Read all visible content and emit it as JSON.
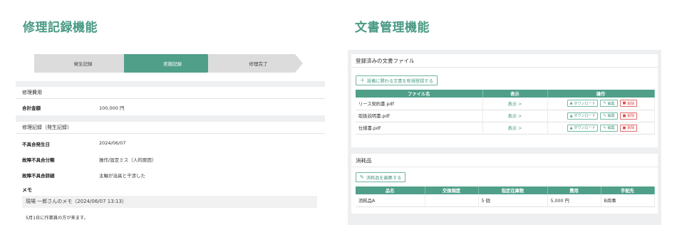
{
  "headings": {
    "left": "修理記録機能",
    "right": "文書管理機能"
  },
  "stepper": {
    "steps": [
      "発生記録",
      "実施記録",
      "修理完了"
    ],
    "active_index": 1
  },
  "repair_cost": {
    "title": "修理費用",
    "total_label": "合計金額",
    "total_value": "100,000 円"
  },
  "repair_record": {
    "title": "修理記録（発生記録）",
    "fields": [
      {
        "label": "不具合発生日",
        "value": "2024/06/07"
      },
      {
        "label": "故障不具合分類",
        "value": "操作/設定ミス（人的原因）"
      },
      {
        "label": "故障不具合詳細",
        "value": "主軸が治具と干渉した"
      }
    ],
    "memo_label": "メモ",
    "memo_header": "現場 一郎さんのメモ（2024/06/07 13:13）",
    "memo_body": "5月1日に作業員の方が来ます。"
  },
  "documents": {
    "title": "登録済みの文書ファイル",
    "add_button": "設備に関わる文書を新規登録する",
    "columns": [
      "ファイル名",
      "表示",
      "操作"
    ],
    "rows": [
      {
        "name": "リース契約書.pdf",
        "show": "表示 >"
      },
      {
        "name": "取扱説明書.pdf",
        "show": "表示 >"
      },
      {
        "name": "仕様書.pdf",
        "show": "表示 >"
      }
    ],
    "op_labels": {
      "download": "ダウンロード",
      "edit": "編集",
      "delete": "削除"
    }
  },
  "consumables": {
    "title": "消耗品",
    "edit_button": "消耗品を編集する",
    "columns": [
      "品名",
      "交換頻度",
      "指定在庫数",
      "費用",
      "手配先"
    ],
    "rows": [
      {
        "name": "消耗品A",
        "frequency": "",
        "stock": "5 個",
        "cost": "5,000 円",
        "supplier": "B商事"
      }
    ]
  },
  "colors": {
    "accent": "#4f9f89",
    "heading": "#4a9a84",
    "delete": "#d94c4c",
    "panel_bg": "#eeeff1"
  },
  "icons": {
    "add": "plus-icon",
    "edit": "pencil-icon",
    "download": "download-icon",
    "delete": "trash-icon"
  }
}
